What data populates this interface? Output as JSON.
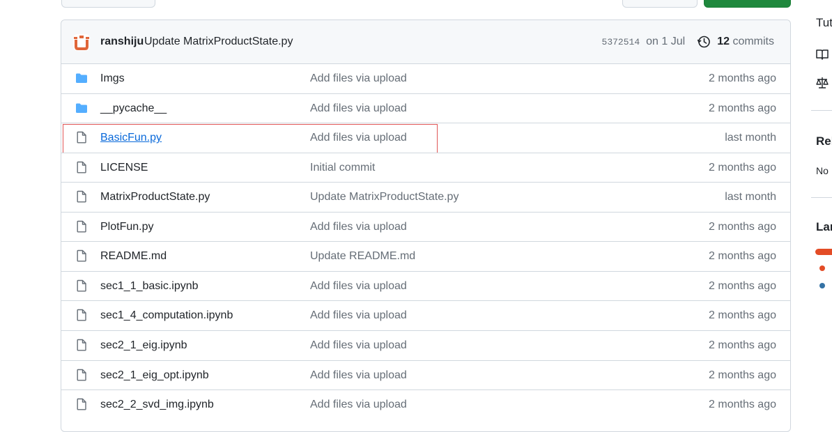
{
  "colors": {
    "folder": "#54aeff",
    "link": "#0969da",
    "muted": "#656d76",
    "highlight": "#e05555",
    "lang_primary": "#e34c26",
    "lang_secondary": "#3572a5"
  },
  "latest_commit": {
    "avatar_icon": "user-avatar-icon",
    "author": "ranshiju",
    "message": "Update MatrixProductState.py",
    "sha": "5372514",
    "date": "on 1 Jul",
    "history_icon": "history-icon",
    "commit_count": "12",
    "commits_label": "commits"
  },
  "files": [
    {
      "name": "Imgs",
      "type": "folder",
      "icon": "folder-icon",
      "commit_message": "Add files via upload",
      "age": "2 months ago"
    },
    {
      "name": "__pycache__",
      "type": "folder",
      "icon": "folder-icon",
      "commit_message": "Add files via upload",
      "age": "2 months ago"
    },
    {
      "name": "BasicFun.py",
      "type": "file",
      "icon": "file-icon",
      "commit_message": "Add files via upload",
      "age": "last month",
      "highlighted": true
    },
    {
      "name": "LICENSE",
      "type": "file",
      "icon": "file-icon",
      "commit_message": "Initial commit",
      "age": "2 months ago"
    },
    {
      "name": "MatrixProductState.py",
      "type": "file",
      "icon": "file-icon",
      "commit_message": "Update MatrixProductState.py",
      "age": "last month"
    },
    {
      "name": "PlotFun.py",
      "type": "file",
      "icon": "file-icon",
      "commit_message": "Add files via upload",
      "age": "2 months ago"
    },
    {
      "name": "README.md",
      "type": "file",
      "icon": "file-icon",
      "commit_message": "Update README.md",
      "age": "2 months ago"
    },
    {
      "name": "sec1_1_basic.ipynb",
      "type": "file",
      "icon": "file-icon",
      "commit_message": "Add files via upload",
      "age": "2 months ago"
    },
    {
      "name": "sec1_4_computation.ipynb",
      "type": "file",
      "icon": "file-icon",
      "commit_message": "Add files via upload",
      "age": "2 months ago"
    },
    {
      "name": "sec2_1_eig.ipynb",
      "type": "file",
      "icon": "file-icon",
      "commit_message": "Add files via upload",
      "age": "2 months ago"
    },
    {
      "name": "sec2_1_eig_opt.ipynb",
      "type": "file",
      "icon": "file-icon",
      "commit_message": "Add files via upload",
      "age": "2 months ago"
    },
    {
      "name": "sec2_2_svd_img.ipynb",
      "type": "file",
      "icon": "file-icon",
      "commit_message": "Add files via upload",
      "age": "2 months ago"
    }
  ],
  "sidebar": {
    "about_fragment": "Tut",
    "readme_icon": "book-icon",
    "license_icon": "law-icon",
    "releases_fragment": "Rel",
    "releases_text_fragment": "No",
    "languages_fragment": "Lan"
  }
}
